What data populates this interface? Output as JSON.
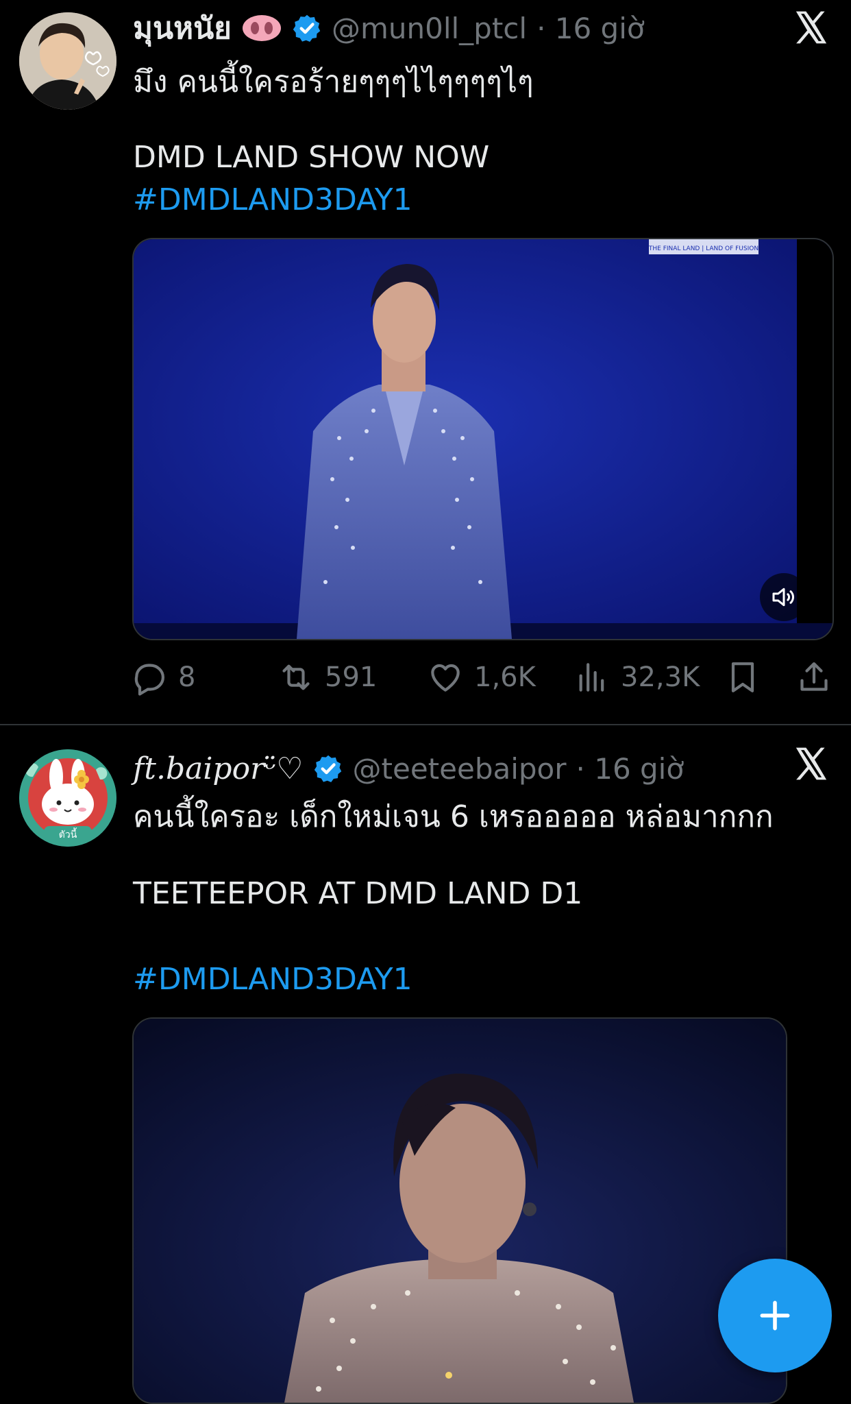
{
  "tweets": [
    {
      "display_name": "มุนหนัย",
      "handle": "@mun0ll_ptcl",
      "time": "· 16 giờ",
      "line1": "มึง คนนี้ใครอร้ายๆๆๆไไๆๆๆๆไๆ",
      "line2": "DMD LAND SHOW NOW",
      "hashtag": "#DMDLAND3DAY1",
      "media_watermark": "THE FINAL LAND | LAND OF FUSION",
      "replies": "8",
      "reposts": "591",
      "likes": "1,6K",
      "views": "32,3K"
    },
    {
      "display_name": "ft.baipor",
      "name_suffix": "ᵕ̈♡",
      "handle": "@teeteebaipor",
      "time": "· 16 giờ",
      "line1": "คนนี้ใครอะ เด็กใหม่เจน 6 เหรอออออ หล่อมากกก",
      "line2": "TEETEEPOR AT DMD LAND D1",
      "hashtag": "#DMDLAND3DAY1",
      "avatar_text": "ตัวนี้"
    }
  ],
  "colors": {
    "background": "#000000",
    "text": "#e7e9ea",
    "muted": "#71767b",
    "accent": "#1d9bf0",
    "divider": "#2f3336"
  },
  "icons": [
    "verified-badge-icon",
    "x-logo-icon",
    "reply-icon",
    "repost-icon",
    "like-icon",
    "views-icon",
    "bookmark-icon",
    "share-icon",
    "volume-icon",
    "plus-icon"
  ]
}
